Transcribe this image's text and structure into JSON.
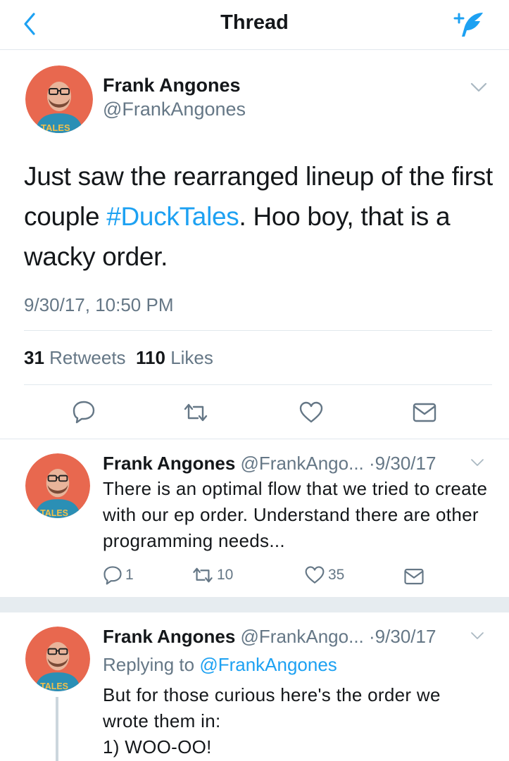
{
  "nav": {
    "title": "Thread",
    "back_icon": "chevron-left-icon",
    "compose_icon": "compose-quill-icon"
  },
  "colors": {
    "accent": "#1da1f2",
    "secondary_text": "#657786",
    "divider": "#e1e8ed"
  },
  "main_tweet": {
    "name": "Frank Angones",
    "handle": "@FrankAngones",
    "text_before": "Just saw the rearranged lineup of the first couple ",
    "hashtag": "#DuckTales",
    "text_after": ". Hoo boy, that is a wacky order.",
    "timestamp": "9/30/17, 10:50 PM",
    "retweets_count": "31",
    "retweets_label": "Retweets",
    "likes_count": "110",
    "likes_label": "Likes"
  },
  "replies": [
    {
      "name": "Frank Angones",
      "handle": "@FrankAngo...",
      "date": "·9/30/17",
      "text": "There is an optimal flow that we tried to create with our ep order. Understand there are other programming needs...",
      "reply_count": "1",
      "retweet_count": "10",
      "like_count": "35"
    },
    {
      "name": "Frank Angones",
      "handle": "@FrankAngo...",
      "date": "·9/30/17",
      "replying_prefix": "Replying to",
      "replying_to": "@FrankAngones",
      "text_line1": "But for those curious here's the order we wrote them in:",
      "text_line2": "1) WOO-OO!"
    }
  ]
}
